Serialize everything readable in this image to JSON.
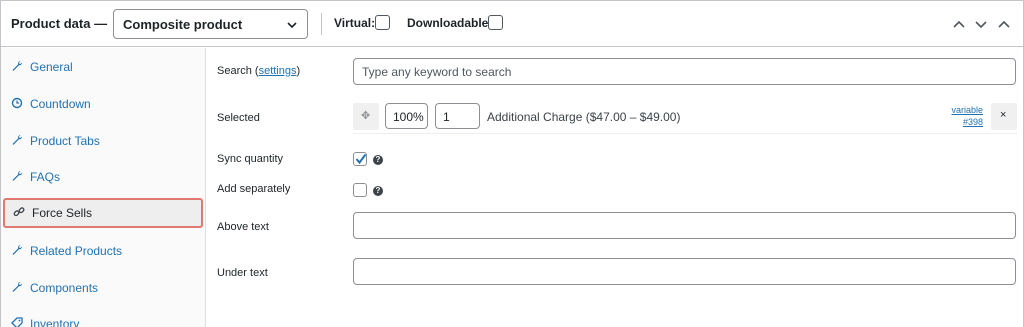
{
  "header": {
    "title": "Product data —",
    "product_type": "Composite product",
    "virtual_label": "Virtual:",
    "downloadable_label": "Downloadable:",
    "virtual_checked": false,
    "downloadable_checked": false
  },
  "sidebar": {
    "items": [
      {
        "label": "General",
        "icon": "wrench-icon"
      },
      {
        "label": "Countdown",
        "icon": "clock-icon"
      },
      {
        "label": "Product Tabs",
        "icon": "wrench-icon"
      },
      {
        "label": "FAQs",
        "icon": "wrench-icon"
      },
      {
        "label": "Force Sells",
        "icon": "link-icon",
        "active": true
      },
      {
        "label": "Related Products",
        "icon": "wrench-icon"
      },
      {
        "label": "Components",
        "icon": "wrench-icon"
      },
      {
        "label": "Inventory",
        "icon": "tag-icon"
      }
    ]
  },
  "main": {
    "search": {
      "label": "Search (",
      "link": "settings",
      "label_end": ")",
      "placeholder": "Type any keyword to search"
    },
    "selected": {
      "label": "Selected",
      "move_glyph": "✥",
      "percent": "100%",
      "quantity": "1",
      "product_name": "Additional Charge ($47.00 – $49.00)",
      "product_type": "variable",
      "product_id": "#398",
      "remove_glyph": "×"
    },
    "sync_quantity": {
      "label": "Sync quantity",
      "checked": true
    },
    "add_separately": {
      "label": "Add separately",
      "checked": false
    },
    "above_text": {
      "label": "Above text",
      "value": ""
    },
    "under_text": {
      "label": "Under text",
      "value": ""
    }
  },
  "colors": {
    "link": "#2271b1",
    "active_outline": "#e07a70",
    "checkbox_check": "#2271b1"
  }
}
